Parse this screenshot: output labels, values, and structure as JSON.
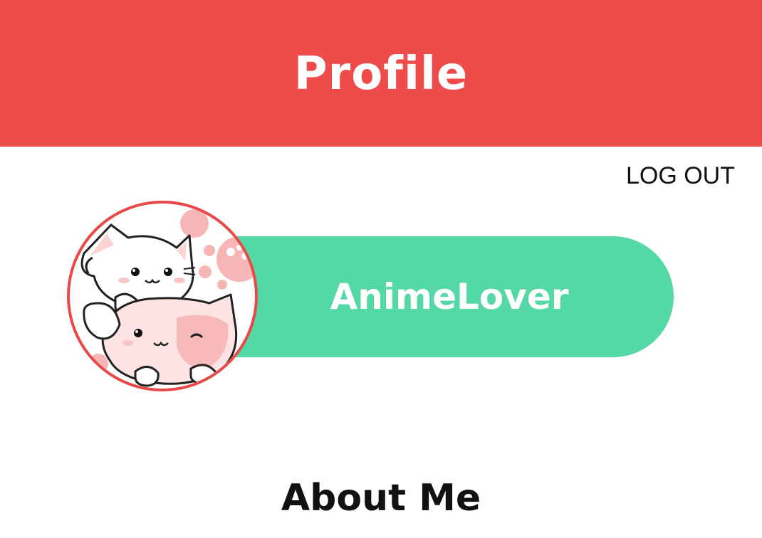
{
  "header": {
    "title": "Profile",
    "color": "#ef4b4a"
  },
  "actions": {
    "logout_label": "LOG OUT"
  },
  "profile": {
    "username": "AnimeLover",
    "pill_color": "#54d8a5",
    "avatar_icon": "kawaii-cats-avatar",
    "avatar_border_color": "#e84a4a"
  },
  "sections": {
    "about_title": "About Me"
  }
}
